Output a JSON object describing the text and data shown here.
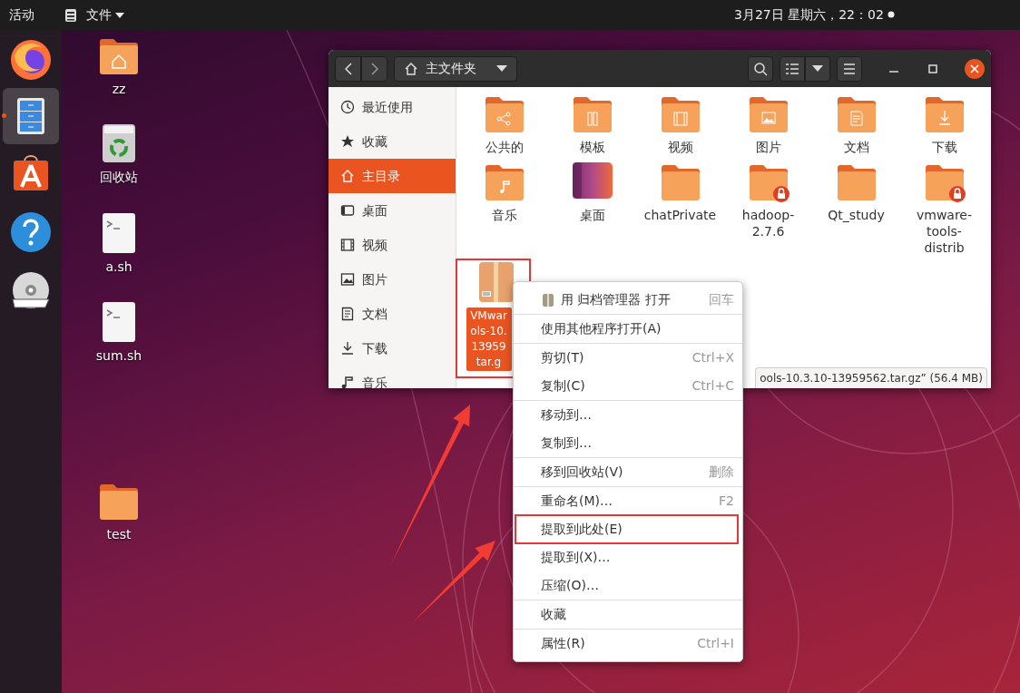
{
  "top_bar": {
    "activities": "活动",
    "app_menu": "文件",
    "clock": "3月27日 星期六，22：02"
  },
  "dock": [
    {
      "kind": "browser",
      "active": false
    },
    {
      "kind": "files",
      "active": true
    },
    {
      "kind": "store",
      "active": false
    },
    {
      "kind": "help",
      "active": false
    },
    {
      "kind": "disc",
      "active": false
    }
  ],
  "desktop_icons": [
    {
      "kind": "home-folder",
      "label": "zz"
    },
    {
      "kind": "trash",
      "label": "回收站"
    },
    {
      "kind": "script",
      "label": "a.sh"
    },
    {
      "kind": "script",
      "label": "sum.sh"
    },
    {
      "kind": "folder",
      "label": "test"
    }
  ],
  "window": {
    "location": "主文件夹",
    "sidebar": [
      {
        "kind": "clock",
        "label": "最近使用",
        "selected": false
      },
      {
        "kind": "star",
        "label": "收藏",
        "selected": false
      },
      {
        "kind": "home",
        "label": "主目录",
        "selected": true
      },
      {
        "kind": "desktop",
        "label": "桌面",
        "selected": false
      },
      {
        "kind": "video",
        "label": "视频",
        "selected": false
      },
      {
        "kind": "picture",
        "label": "图片",
        "selected": false
      },
      {
        "kind": "document",
        "label": "文档",
        "selected": false
      },
      {
        "kind": "download",
        "label": "下载",
        "selected": false
      },
      {
        "kind": "music",
        "label": "音乐",
        "selected": false
      }
    ],
    "files": [
      {
        "kind": "share",
        "label": "公共的",
        "locked": false,
        "selected": false
      },
      {
        "kind": "template",
        "label": "模板",
        "locked": false,
        "selected": false
      },
      {
        "kind": "video",
        "label": "视频",
        "locked": false,
        "selected": false
      },
      {
        "kind": "picture",
        "label": "图片",
        "locked": false,
        "selected": false
      },
      {
        "kind": "document",
        "label": "文档",
        "locked": false,
        "selected": false
      },
      {
        "kind": "download",
        "label": "下载",
        "locked": false,
        "selected": false
      },
      {
        "kind": "music",
        "label": "音乐",
        "locked": false,
        "selected": false
      },
      {
        "kind": "desktop",
        "label": "桌面",
        "locked": false,
        "selected": false
      },
      {
        "kind": "folder",
        "label": "chatPrivate",
        "locked": false,
        "selected": false
      },
      {
        "kind": "folder",
        "label": "hadoop-\n2.7.6",
        "locked": true,
        "selected": false
      },
      {
        "kind": "folder",
        "label": "Qt_study",
        "locked": false,
        "selected": false
      },
      {
        "kind": "folder",
        "label": "vmware-\ntools-\ndistrib",
        "locked": true,
        "selected": false
      },
      {
        "kind": "archive",
        "label": "VMwar\nols-10.\n13959\ntar.g",
        "locked": false,
        "selected": true,
        "outlined": true
      }
    ],
    "status": "ools-10.3.10-13959562.tar.gz” (56.4 MB)"
  },
  "context_menu": [
    {
      "label": "用 归档管理器 打开",
      "shortcut": "回车",
      "icon": true,
      "separator_after": true,
      "outlined": false
    },
    {
      "label": "使用其他程序打开(A)",
      "separator_after": true,
      "outlined": false
    },
    {
      "label": "剪切(T)",
      "shortcut": "Ctrl+X",
      "separator_after": false,
      "outlined": false
    },
    {
      "label": "复制(C)",
      "shortcut": "Ctrl+C",
      "separator_after": true,
      "outlined": false
    },
    {
      "label": "移动到…",
      "separator_after": false,
      "outlined": false
    },
    {
      "label": "复制到…",
      "separator_after": true,
      "outlined": false
    },
    {
      "label": "移到回收站(V)",
      "shortcut": "删除",
      "separator_after": true,
      "outlined": false
    },
    {
      "label": "重命名(M)…",
      "shortcut": "F2",
      "separator_after": false,
      "outlined": false
    },
    {
      "label": "提取到此处(E)",
      "separator_after": false,
      "outlined": true
    },
    {
      "label": "提取到(X)…",
      "separator_after": false,
      "outlined": false
    },
    {
      "label": "压缩(O)…",
      "separator_after": true,
      "outlined": false
    },
    {
      "label": "收藏",
      "separator_after": true,
      "outlined": false
    },
    {
      "label": "属性(R)",
      "shortcut": "Ctrl+I",
      "separator_after": false,
      "outlined": false
    }
  ],
  "annotation_arrows": [
    {
      "kind": "arrow"
    },
    {
      "kind": "arrow"
    }
  ]
}
